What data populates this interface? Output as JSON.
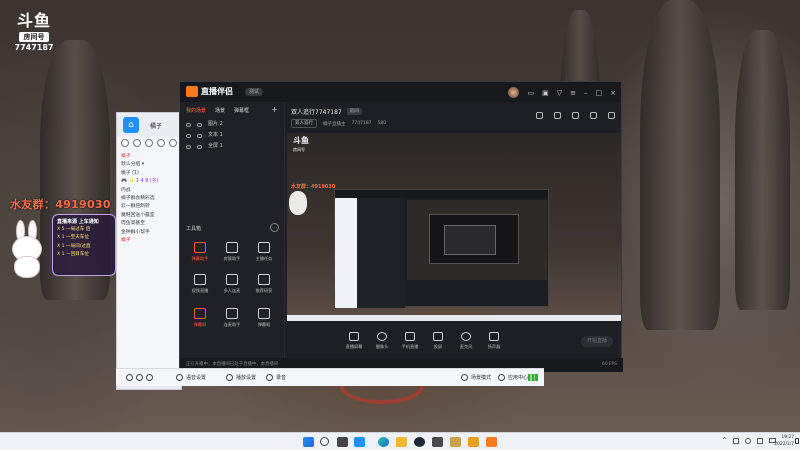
{
  "douyu": {
    "logo_text": "斗鱼",
    "room_label": "房间号",
    "room_id": "7747187"
  },
  "rabbit_overlay": {
    "ticker": "水友群：4919030",
    "card_title": "直播来源 上车通知",
    "lines": [
      "X 5 一局过车 后",
      "X 1 一至天车位",
      "X 1 一局间/过直",
      "X 1 一回目车位"
    ]
  },
  "qq_window": {
    "name": "橘子",
    "list": [
      "橘子",
      "默认分组 ▾",
      "橘子 (1)",
      "🎮 ✨ 1 4 9 (子)",
      "内战",
      "橘子群会精彩选",
      "云一群控制转",
      "魔鞋回送小露室",
      "周鱼高基至",
      "金钟群小帮手",
      "橘子"
    ]
  },
  "assistant": {
    "brand": "直播伴侣",
    "version": "测试",
    "tabs": [
      "我的场景",
      "场景",
      "弹幕框"
    ],
    "tab_add": "+",
    "sources": [
      "图片 2",
      "文本 1",
      "全屏 1"
    ],
    "tools_title": "工具箱",
    "tools": [
      {
        "label": "弹幕助手",
        "icon": "barrage-icon",
        "hot": true
      },
      {
        "label": "房管助手",
        "icon": "admin-icon",
        "hot": false
      },
      {
        "label": "主播任务",
        "icon": "task-icon",
        "hot": false
      },
      {
        "label": "视频直播",
        "icon": "video-icon",
        "hot": false
      },
      {
        "label": "多人连麦",
        "icon": "link-mic-icon",
        "hot": false
      },
      {
        "label": "推荐码获",
        "icon": "code-icon",
        "hot": false
      },
      {
        "label": "弹幕屏",
        "icon": "screen-icon",
        "hot": true
      },
      {
        "label": "连麦助手",
        "icon": "assist-icon",
        "hot": false
      },
      {
        "label": "弹幕框",
        "icon": "frame-icon",
        "hot": false
      }
    ],
    "room_title": "双人追行7747187",
    "room_badge": "房间",
    "room_sub_btn": "双人追行",
    "room_sub_info": "橘子直播主",
    "room_sub_id": "7747187",
    "room_sub_extra": "580",
    "controls": [
      "直播屏幕",
      "摄像头",
      "手机直播",
      "投屏",
      "麦克风",
      "扬声器"
    ],
    "start_label": "开始直播",
    "status_left": "正在开播中，本直播间已处于直播中，本直播间",
    "status_right": "60 FPS"
  },
  "preview": {
    "logo_text": "斗鱼",
    "logo_sub": "房间号",
    "ticker": "水友群：4919030"
  },
  "game_bar": {
    "items": [
      "语音设置",
      "播放设置",
      "录音"
    ],
    "right_items": [
      "场景模式",
      "应用中心"
    ]
  },
  "taskbar": {
    "tray_up": "^",
    "clock_time": "19:27",
    "clock_date": "2022/1/7"
  }
}
